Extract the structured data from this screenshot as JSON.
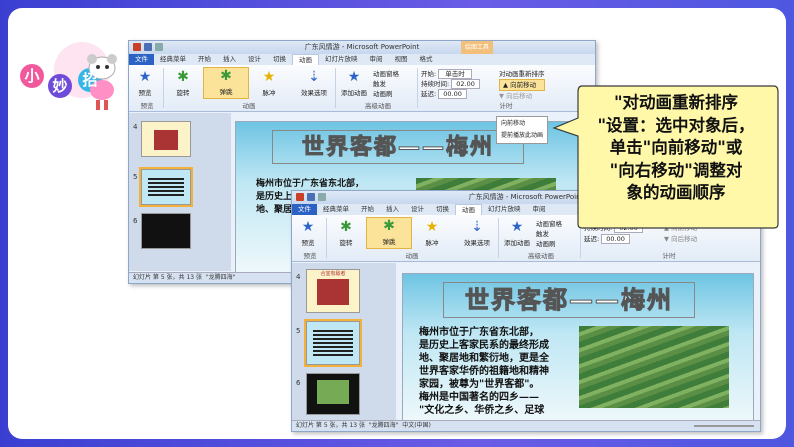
{
  "mascot": {
    "badges": [
      "小",
      "妙",
      "招"
    ]
  },
  "window1": {
    "title": "广东风情游 - Microsoft PowerPoint",
    "context_tab": "绘图工具",
    "tabs": [
      "文件",
      "经典菜单",
      "开始",
      "插入",
      "设计",
      "切换",
      "动画",
      "幻灯片放映",
      "审阅",
      "视图",
      "格式"
    ],
    "preview": "预览",
    "effects": [
      "旋转",
      "弹跳",
      "脉冲"
    ],
    "effect_options": "效果选项",
    "add_animation": "添加动画",
    "advanced": [
      "动画窗格",
      "触发",
      "动画刷"
    ],
    "start_label": "开始:",
    "start_value": "单击时",
    "duration_label": "持续时间:",
    "duration_value": "02.00",
    "delay_label": "延迟:",
    "delay_value": "00.00",
    "reorder_title": "对动画重新排序",
    "move_earlier": "向前移动",
    "move_later": "向后移动",
    "groups": [
      "预览",
      "动画",
      "高级动画",
      "计时"
    ],
    "menu_items": [
      "向前移动",
      "提前播放此动画"
    ],
    "slide_nums": [
      "4",
      "5",
      "6"
    ],
    "status": "幻灯片 第 5 张，共 13 张",
    "theme": "\"龙腾四海\""
  },
  "window2": {
    "title": "广东风情游 - Microsoft PowerPoint",
    "tabs": [
      "文件",
      "经典菜单",
      "开始",
      "插入",
      "设计",
      "切换",
      "动画",
      "幻灯片放映",
      "审阅"
    ],
    "preview": "预览",
    "effects": [
      "旋转",
      "弹跳",
      "脉冲"
    ],
    "effect_options": "效果选项",
    "add_animation": "添加动画",
    "advanced": [
      "动画窗格",
      "触发",
      "动画刷"
    ],
    "duration_label": "持续时间:",
    "duration_value": "02.00",
    "delay_label": "延迟:",
    "delay_value": "00.00",
    "move_earlier": "向前移动",
    "move_later": "向后移动",
    "groups": [
      "预览",
      "动画",
      "高级动画",
      "计时"
    ],
    "slide_nums": [
      "4",
      "5",
      "6"
    ],
    "status": "幻灯片 第 5 张，共 13 张",
    "theme": "\"龙腾四海\"",
    "lang": "中文(中国)"
  },
  "slide": {
    "title": "世界客都——梅州",
    "body_lines": [
      "梅州市位于广东省东北部，",
      "是历史上客家民系的最终形成",
      "地、聚居地和繁衍地，更是全",
      "世界客家华侨的祖籍地和精神",
      "家园，被尊为\"世界客都\"。",
      "梅州是中国著名的四乡——",
      "\"文化之乡、华侨之乡、足球"
    ],
    "thumb_title": "合宜有敌者"
  },
  "callout": {
    "lines": [
      "\"对动画重新排序",
      "\"设置：选中对象后，",
      "单击\"向前移动\"或",
      "\"向右移动\"调整对",
      "象的动画顺序"
    ]
  }
}
